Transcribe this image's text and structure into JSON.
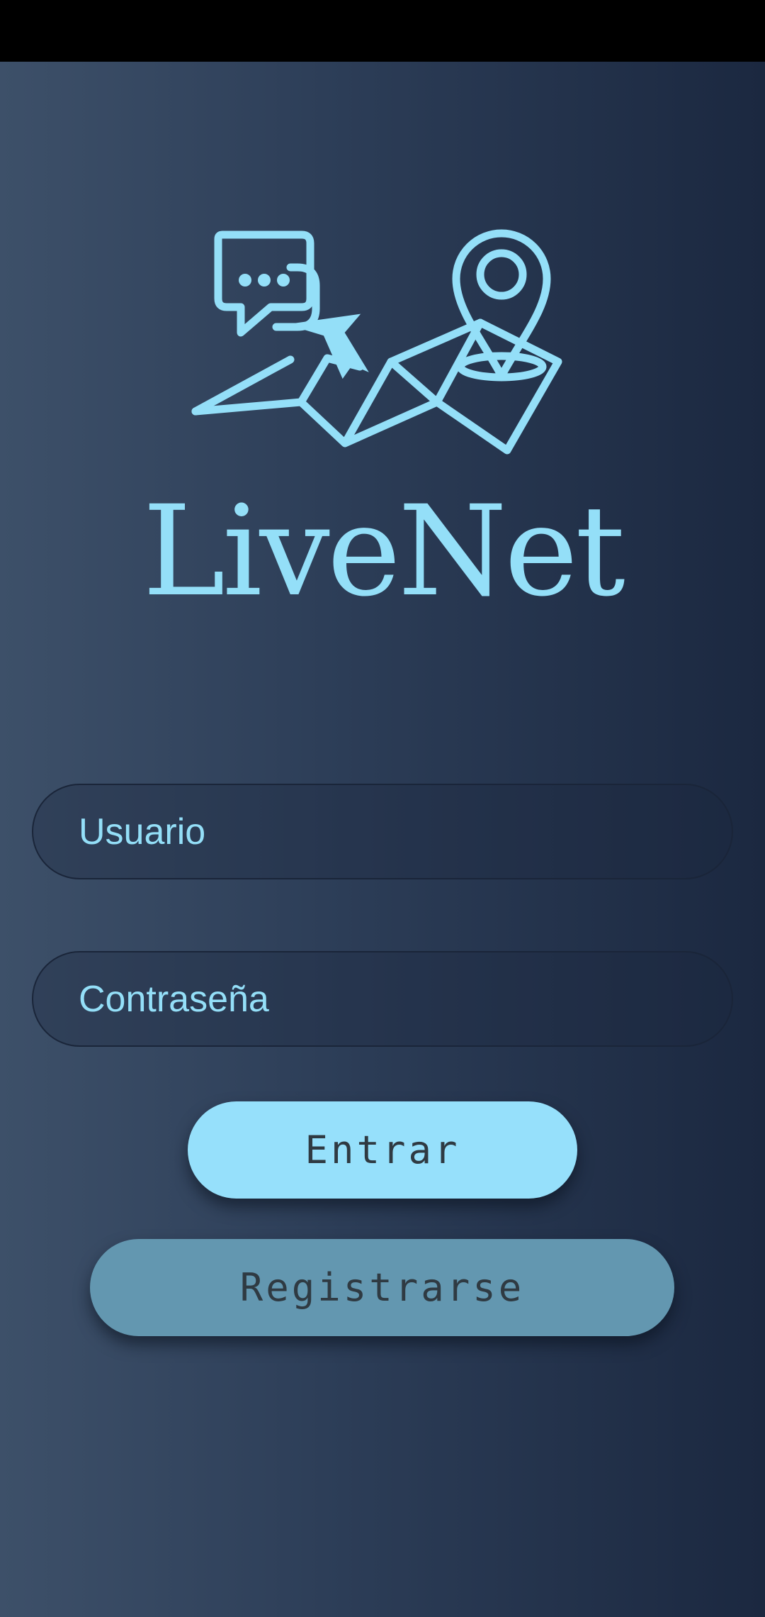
{
  "app": {
    "name": "LiveNet"
  },
  "login": {
    "username_placeholder": "Usuario",
    "password_placeholder": "Contraseña",
    "login_label": "Entrar",
    "register_label": "Registrarse"
  },
  "colors": {
    "accent": "#94dff8",
    "login_button": "#96e0fb",
    "register_button": "#6397b0",
    "background_left": "#3d5069",
    "background_right": "#1b2840"
  },
  "icons": {
    "logo": "chat-bubble-map-pin-logo-icon"
  }
}
